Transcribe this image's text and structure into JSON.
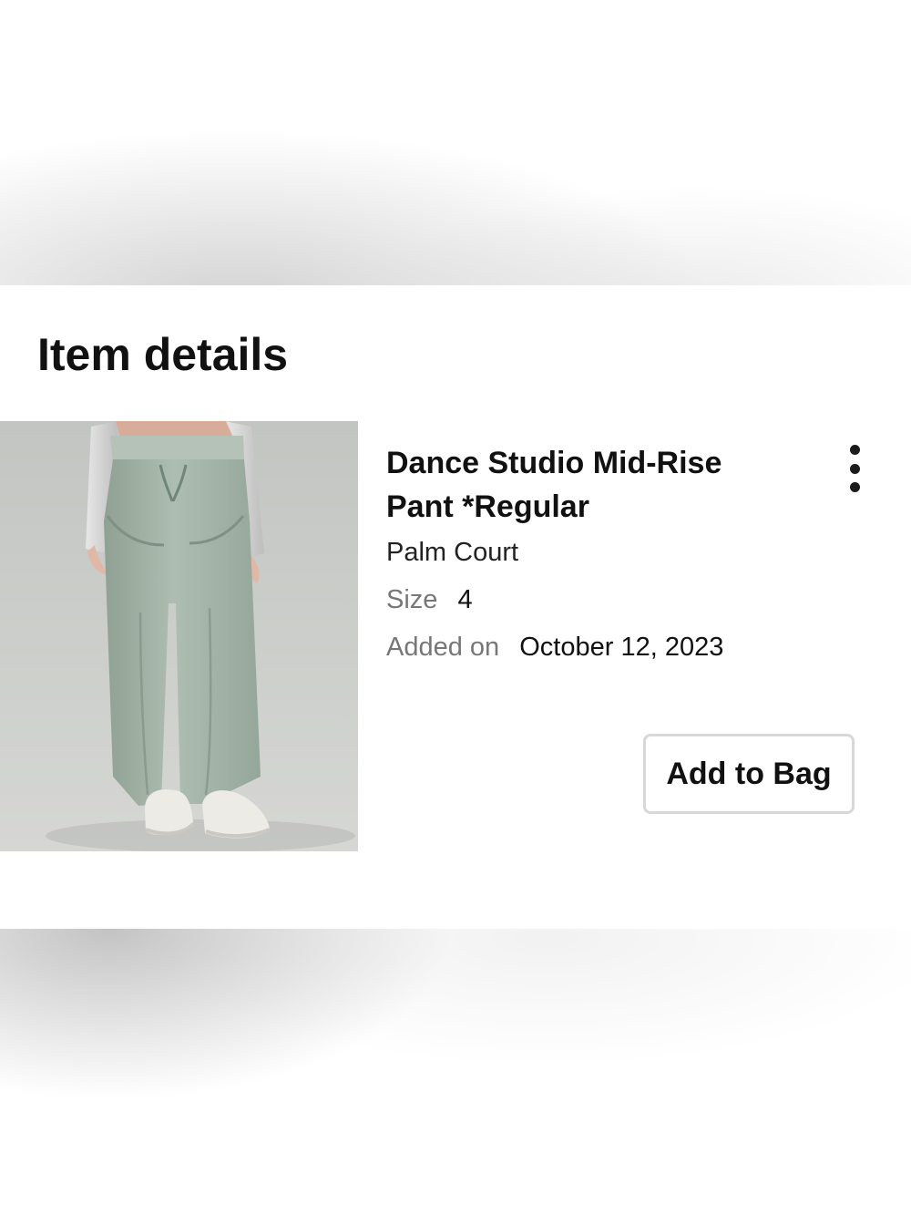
{
  "page": {
    "title": "Item details"
  },
  "item": {
    "name": "Dance Studio Mid-Rise Pant *Regular",
    "color": "Palm Court",
    "size_label": "Size",
    "size_value": "4",
    "added_label": "Added on",
    "added_value": "October 12, 2023",
    "image_icon": "product-image-icon",
    "more_icon": "vertical-ellipsis-icon"
  },
  "actions": {
    "add_to_bag_label": "Add to Bag"
  },
  "colors": {
    "text_primary": "#111111",
    "text_secondary": "#777777",
    "button_border": "#d8d8d8",
    "image_background": "#c7c9c6",
    "pant_green": "#a4b3a6"
  }
}
